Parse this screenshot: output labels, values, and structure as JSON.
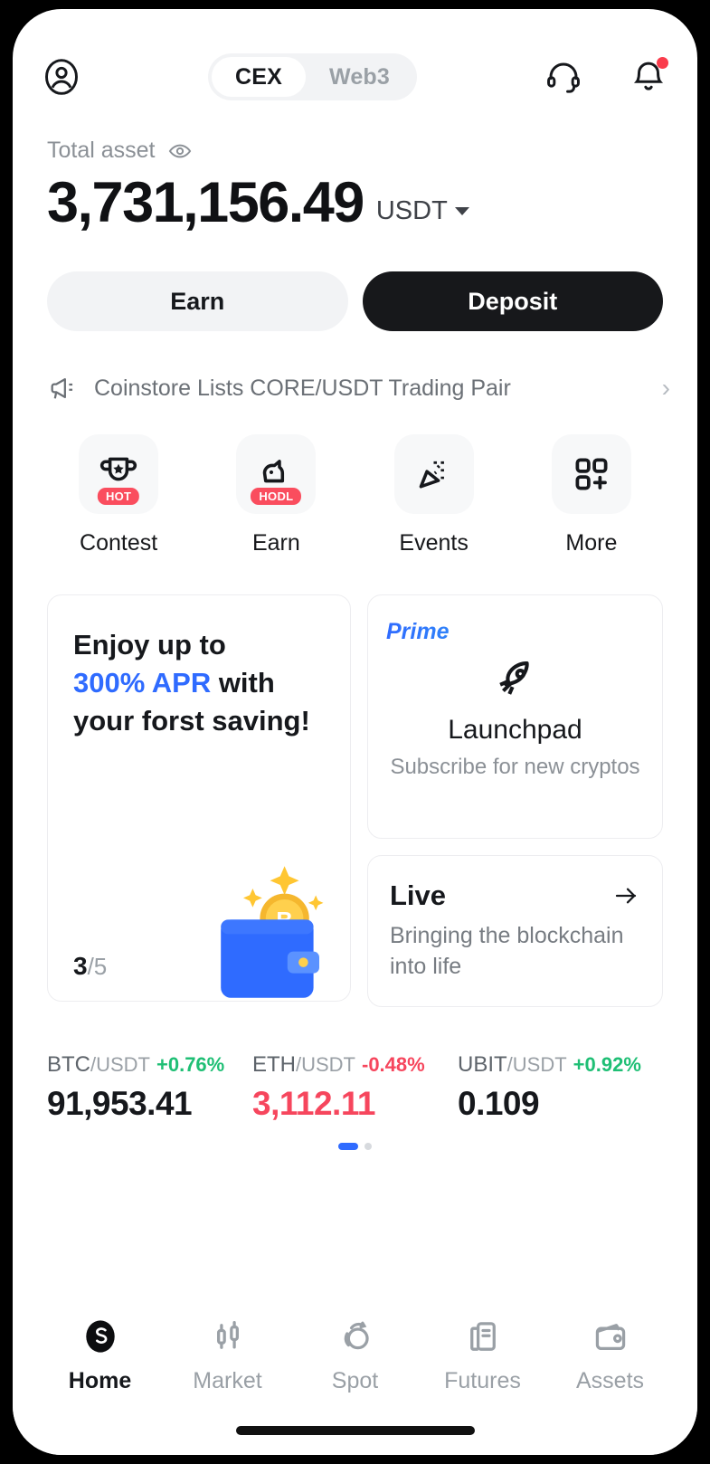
{
  "header": {
    "profile_icon": "user-circle-icon",
    "tabs": [
      {
        "label": "CEX",
        "active": true
      },
      {
        "label": "Web3",
        "active": false
      }
    ],
    "support_icon": "headset-icon",
    "notification_icon": "bell-icon",
    "has_notification_dot": true
  },
  "balance": {
    "label": "Total asset",
    "eye_icon": "eye-icon",
    "amount": "3,731,156.49",
    "currency": "USDT"
  },
  "actions": {
    "earn_label": "Earn",
    "deposit_label": "Deposit"
  },
  "announcement": {
    "icon": "megaphone-icon",
    "text": "Coinstore Lists CORE/USDT Trading Pair",
    "chevron": "›"
  },
  "quick_actions": [
    {
      "label": "Contest",
      "icon": "trophy-icon",
      "badge": "HOT"
    },
    {
      "label": "Earn",
      "icon": "piggy-hodl-icon",
      "badge": "HODL"
    },
    {
      "label": "Events",
      "icon": "confetti-icon",
      "badge": ""
    },
    {
      "label": "More",
      "icon": "grid-plus-icon",
      "badge": ""
    }
  ],
  "promos": {
    "saving": {
      "line1": "Enjoy up to",
      "highlight": "300% APR",
      "line2_tail": " with",
      "line3": "your forst saving!",
      "counter_current": "3",
      "counter_total": "/5",
      "art": "wallet-bitcoin-icon"
    },
    "prime": {
      "tag": "Prime",
      "icon": "rocket-icon",
      "title": "Launchpad",
      "subtitle": "Subscribe for new cryptos"
    },
    "live": {
      "title": "Live",
      "arrow_icon": "arrow-right-icon",
      "subtitle": "Bringing the blockchain into life"
    }
  },
  "tickers": [
    {
      "pair": "BTC",
      "quote": "/USDT",
      "change": "+0.76%",
      "direction": "up",
      "price": "91,953.41",
      "price_color": "neutral"
    },
    {
      "pair": "ETH",
      "quote": "/USDT",
      "change": "-0.48%",
      "direction": "down",
      "price": "3,112.11",
      "price_color": "down"
    },
    {
      "pair": "UBIT",
      "quote": "/USDT",
      "change": "+0.92%",
      "direction": "up",
      "price": "0.109",
      "price_color": "neutral"
    }
  ],
  "carousel": {
    "total_dots": 2,
    "active_index": 0
  },
  "nav": [
    {
      "label": "Home",
      "icon": "coinstore-logo-icon",
      "active": true
    },
    {
      "label": "Market",
      "icon": "candlestick-icon",
      "active": false
    },
    {
      "label": "Spot",
      "icon": "spot-swap-icon",
      "active": false
    },
    {
      "label": "Futures",
      "icon": "futures-doc-icon",
      "active": false
    },
    {
      "label": "Assets",
      "icon": "wallet-icon",
      "active": false
    }
  ],
  "colors": {
    "accent_blue": "#2f6bff",
    "up_green": "#1fbf75",
    "down_red": "#f6465d",
    "badge_red": "#fa4d5e",
    "dark": "#17181b"
  }
}
